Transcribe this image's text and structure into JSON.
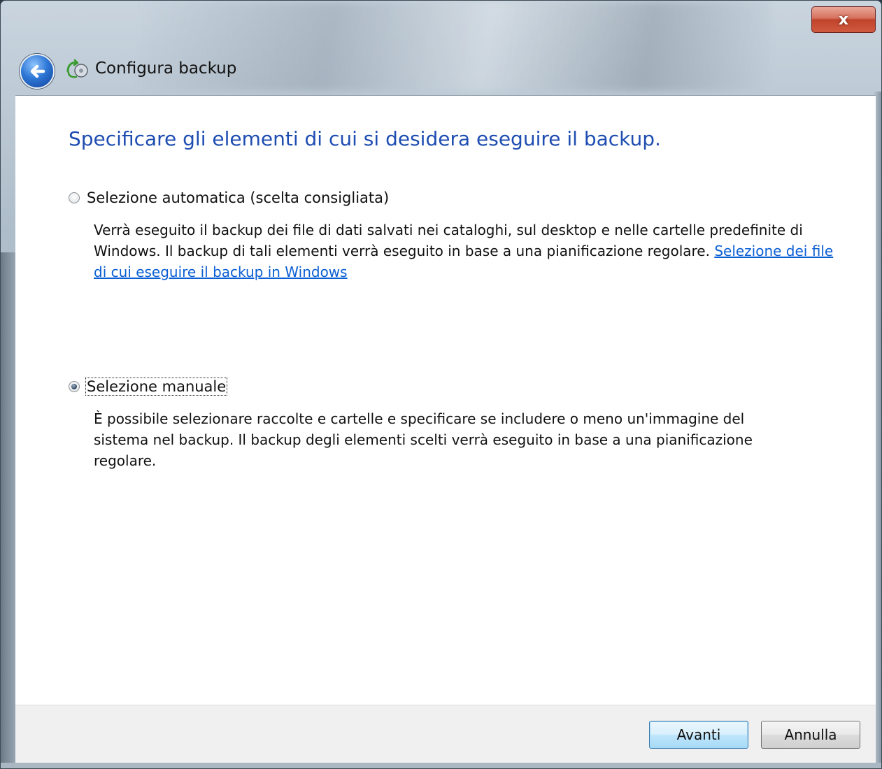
{
  "window": {
    "title": "Configura backup",
    "close_glyph": "x"
  },
  "content": {
    "heading": "Specificare gli elementi di cui si desidera eseguire il backup.",
    "options": [
      {
        "label": "Selezione automatica (scelta consigliata)",
        "selected": false,
        "description": "Verrà eseguito il backup dei file di dati salvati nei cataloghi, sul desktop e nelle cartelle predefinite di Windows. Il backup di tali elementi verrà eseguito in base a una pianificazione regolare.",
        "link": "Selezione dei file di cui eseguire il backup in Windows"
      },
      {
        "label": "Selezione manuale",
        "selected": true,
        "description": "È possibile selezionare raccolte e cartelle e specificare se includere o meno un'immagine del sistema nel backup. Il backup degli elementi scelti verrà eseguito in base a una pianificazione regolare."
      }
    ]
  },
  "footer": {
    "next_label": "Avanti",
    "cancel_label": "Annulla"
  },
  "icons": {
    "back": "back-arrow-icon",
    "title": "backup-icon",
    "close": "close-icon"
  },
  "colors": {
    "heading": "#1e4db1",
    "link": "#0b5fd4",
    "close_button": "#c0432b"
  }
}
